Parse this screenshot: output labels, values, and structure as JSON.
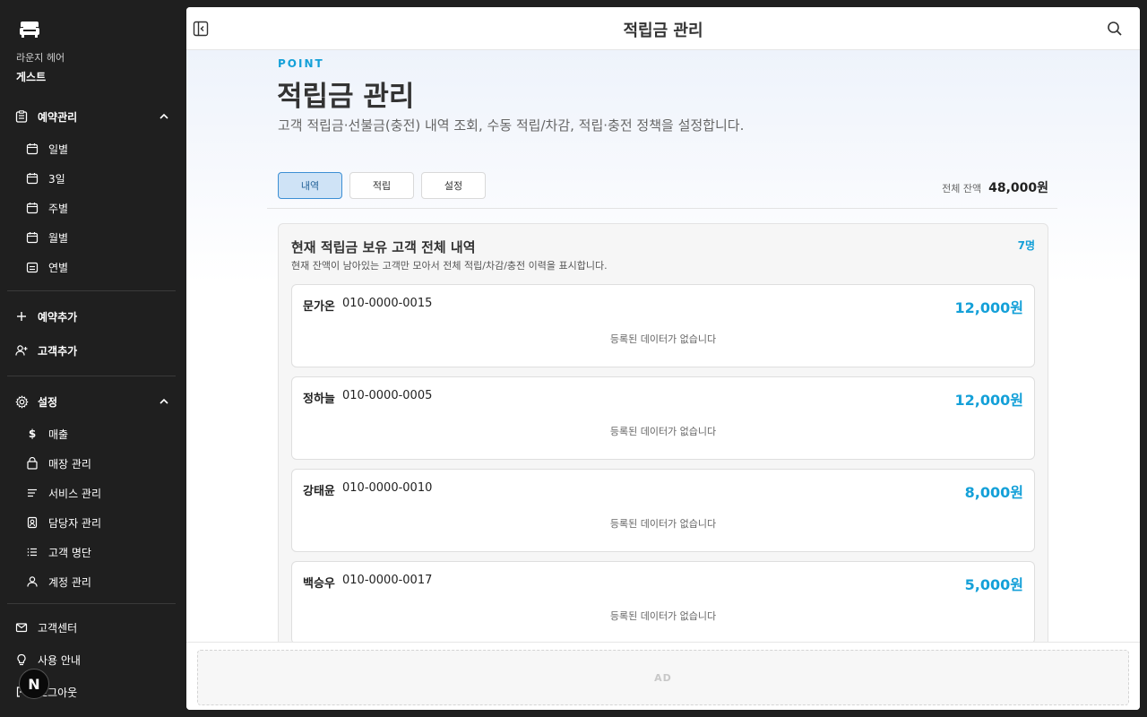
{
  "sidebar": {
    "store_name": "라운지 헤어",
    "user_name": "게스트",
    "reservation": {
      "label": "예약관리",
      "items": [
        "일별",
        "3일",
        "주별",
        "월별",
        "연별"
      ]
    },
    "add_reservation": "예약추가",
    "add_customer": "고객추가",
    "settings": {
      "label": "설정",
      "items": [
        "매출",
        "매장 관리",
        "서비스 관리",
        "담당자 관리",
        "고객 명단",
        "계정 관리"
      ]
    },
    "support": "고객센터",
    "guide": "사용 안내",
    "logout": "로그아웃",
    "avatar_letter": "N"
  },
  "header": {
    "title": "적립금 관리"
  },
  "page": {
    "eyebrow": "POINT",
    "title": "적립금 관리",
    "description": "고객 적립금·선불금(충전) 내역 조회, 수동 적립/차감, 적립·충전 정책을 설정합니다.",
    "tabs": [
      "내역",
      "적립",
      "설정"
    ],
    "active_tab": "내역",
    "balance_label": "전체 잔액",
    "balance_value": "48,000원"
  },
  "panel": {
    "title": "현재 적립금 보유 고객 전체 내역",
    "subtitle": "현재 잔액이 남아있는 고객만 모아서 전체 적립/차감/충전 이력을 표시합니다.",
    "count": "7명",
    "customers": [
      {
        "name": "문가온",
        "phone": "010-0000-0015",
        "amount": "12,000원",
        "empty": "등록된 데이터가 없습니다"
      },
      {
        "name": "정하늘",
        "phone": "010-0000-0005",
        "amount": "12,000원",
        "empty": "등록된 데이터가 없습니다"
      },
      {
        "name": "강태윤",
        "phone": "010-0000-0010",
        "amount": "8,000원",
        "empty": "등록된 데이터가 없습니다"
      },
      {
        "name": "백승우",
        "phone": "010-0000-0017",
        "amount": "5,000원",
        "empty": "등록된 데이터가 없습니다"
      }
    ]
  },
  "footer": {
    "ad": "AD"
  },
  "colors": {
    "accent": "#14a0d8",
    "sidebar_bg": "#1f1f1f",
    "tab_active_bg": "#cfe3f6"
  }
}
